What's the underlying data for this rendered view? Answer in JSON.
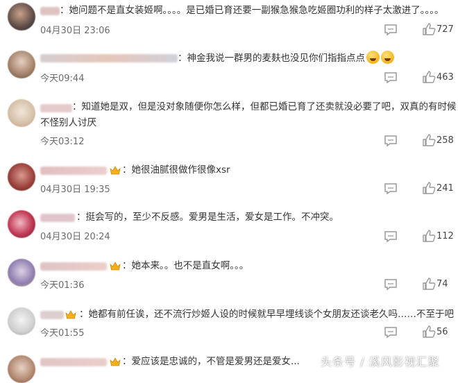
{
  "comments": [
    {
      "text": "：她问题不是直女装姬啊。。。。是已婚已育还要一副猴急猴急吃姬圈功利的样子太激进了。。。。",
      "time": "04月30日 23:06",
      "likes": "727"
    },
    {
      "text": "：神金我说一群男的麦麸也没见你们指指点点",
      "time": "今天09:44",
      "likes": "463"
    },
    {
      "text": "：知道她是双，但是没对象随便你怎么样，但都已婚已育了还卖就没必要了吧，双真的有时候不怪别人讨厌",
      "time": "今天03:12",
      "likes": "258"
    },
    {
      "text": "：她很油腻很做作很像xsr",
      "time": "04月30日 19:35",
      "likes": "241"
    },
    {
      "text": "：挺会写的，至少不反感。爱男是生活，爱女是工作。不冲突。",
      "time": "04月30日 20:24",
      "likes": "112"
    },
    {
      "text": "：她本来。。也不是直女啊。。。",
      "time": "今天01:36",
      "likes": "74"
    },
    {
      "text": "：她都有前任诶，还不流行炒姬人设的时候就早早埋线谈个女朋友还谈老久吗……不至于吧",
      "time": "今天01:55",
      "likes": "56"
    },
    {
      "text": "：爱应该是忠诚的，不管是爱男还是爱女...",
      "time": "",
      "likes": ""
    }
  ],
  "watermark": "头条号 / 溪风影视汇聚",
  "icons": {
    "reply": "reply-comment-icon",
    "like": "thumbs-up-icon",
    "crown": "crown-badge-icon",
    "emoji": "laughing-emoji-icon"
  },
  "colors": {
    "text": "#333333",
    "meta": "#6b6b6b",
    "crown": "#f2b01e"
  }
}
